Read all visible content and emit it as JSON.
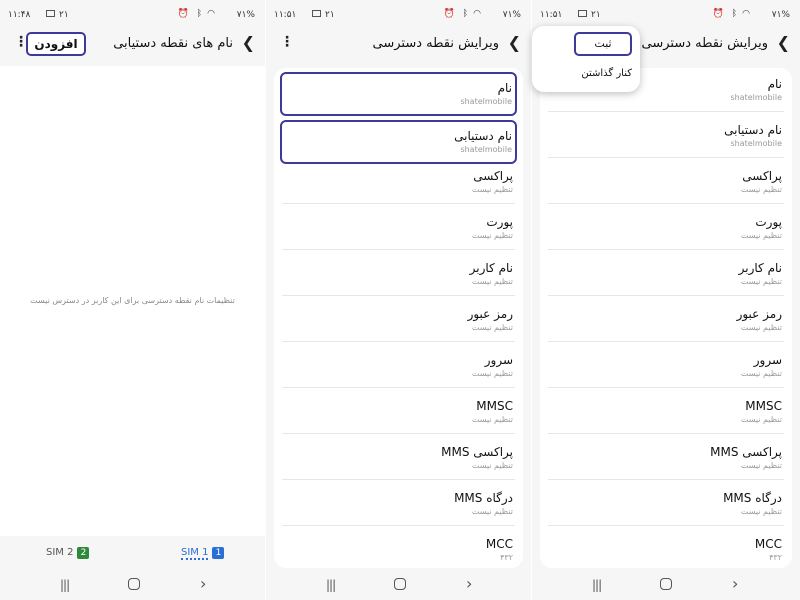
{
  "status1": {
    "time": "۱۱:۴۸",
    "date": "۲۱",
    "battery": "۷۱%"
  },
  "status2": {
    "time": "۱۱:۵۱",
    "date": "۲۱",
    "battery": "۷۱%"
  },
  "status3": {
    "time": "۱۱:۵۱",
    "date": "۲۱",
    "battery": "۷۱%"
  },
  "screen1": {
    "title": "نام های نقطه دستیابی",
    "add_label": "افزودن",
    "empty_message": "تنظیمات نام نقطه دسترسی برای این کاربر در دسترس نیست",
    "sim1_label": "SIM 1",
    "sim1_num": "1",
    "sim2_label": "SIM 2",
    "sim2_num": "2"
  },
  "screen2": {
    "title": "ویرایش نقطه دسترسی",
    "fields": [
      {
        "label": "نام",
        "value": "shatelmobile"
      },
      {
        "label": "نام دستیابی",
        "value": "shatelmobile"
      },
      {
        "label": "پراکسی",
        "value": "تنظیم نیست"
      },
      {
        "label": "پورت",
        "value": "تنظیم نیست"
      },
      {
        "label": "نام کاربر",
        "value": "تنظیم نیست"
      },
      {
        "label": "رمز عبور",
        "value": "تنظیم نیست"
      },
      {
        "label": "سرور",
        "value": "تنظیم نیست"
      },
      {
        "label": "MMSC",
        "value": "تنظیم نیست"
      },
      {
        "label": "پراکسی MMS",
        "value": "تنظیم نیست"
      },
      {
        "label": "درگاه MMS",
        "value": "تنظیم نیست"
      },
      {
        "label": "MCC",
        "value": "۴۳۲"
      }
    ]
  },
  "screen3": {
    "title": "ویرایش نقطه دسترسی",
    "menu_save": "ثبت",
    "menu_discard": "کنار گذاشتن",
    "fields": [
      {
        "label": "نام",
        "value": "shatelmobile"
      },
      {
        "label": "نام دستیابی",
        "value": "shatelmobile"
      },
      {
        "label": "پراکسی",
        "value": "تنظیم نیست"
      },
      {
        "label": "پورت",
        "value": "تنظیم نیست"
      },
      {
        "label": "نام کاربر",
        "value": "تنظیم نیست"
      },
      {
        "label": "رمز عبور",
        "value": "تنظیم نیست"
      },
      {
        "label": "سرور",
        "value": "تنظیم نیست"
      },
      {
        "label": "MMSC",
        "value": "تنظیم نیست"
      },
      {
        "label": "پراکسی MMS",
        "value": "تنظیم نیست"
      },
      {
        "label": "درگاه MMS",
        "value": "تنظیم نیست"
      },
      {
        "label": "MCC",
        "value": "۴۳۲"
      }
    ]
  },
  "icons": {
    "back": "chevron-left-icon",
    "more": "more-vertical-icon",
    "recent": "recent-apps-icon",
    "home": "home-icon",
    "nav_back": "nav-back-icon"
  },
  "colors": {
    "highlight": "#3d3a9a",
    "sim1": "#2a6fd6",
    "sim2": "#2d8a3a"
  }
}
